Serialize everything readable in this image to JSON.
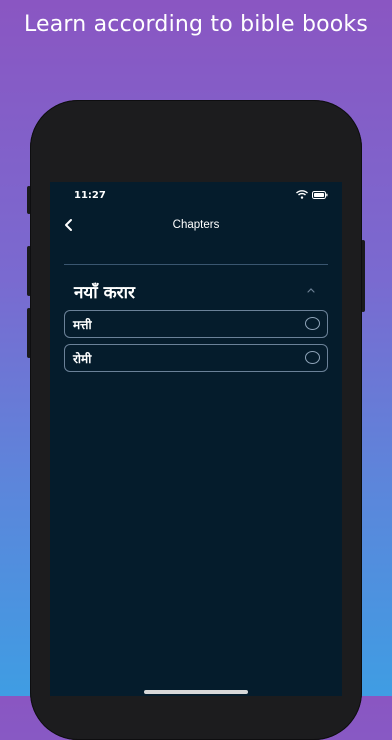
{
  "promo": {
    "headline": "Learn according to bible books"
  },
  "status_bar": {
    "time": "11:27"
  },
  "nav": {
    "title": "Chapters",
    "back_icon": "chevron-left-icon"
  },
  "section": {
    "title": "नयाँ करार",
    "expanded": true
  },
  "books": [
    {
      "name": "मत्ती",
      "selected": false
    },
    {
      "name": "रोमी",
      "selected": false
    }
  ],
  "colors": {
    "screen_background": "#051c2c",
    "row_border": "#6b8198",
    "gradient_top": "#8a56c2",
    "gradient_bottom": "#3f9de3"
  }
}
